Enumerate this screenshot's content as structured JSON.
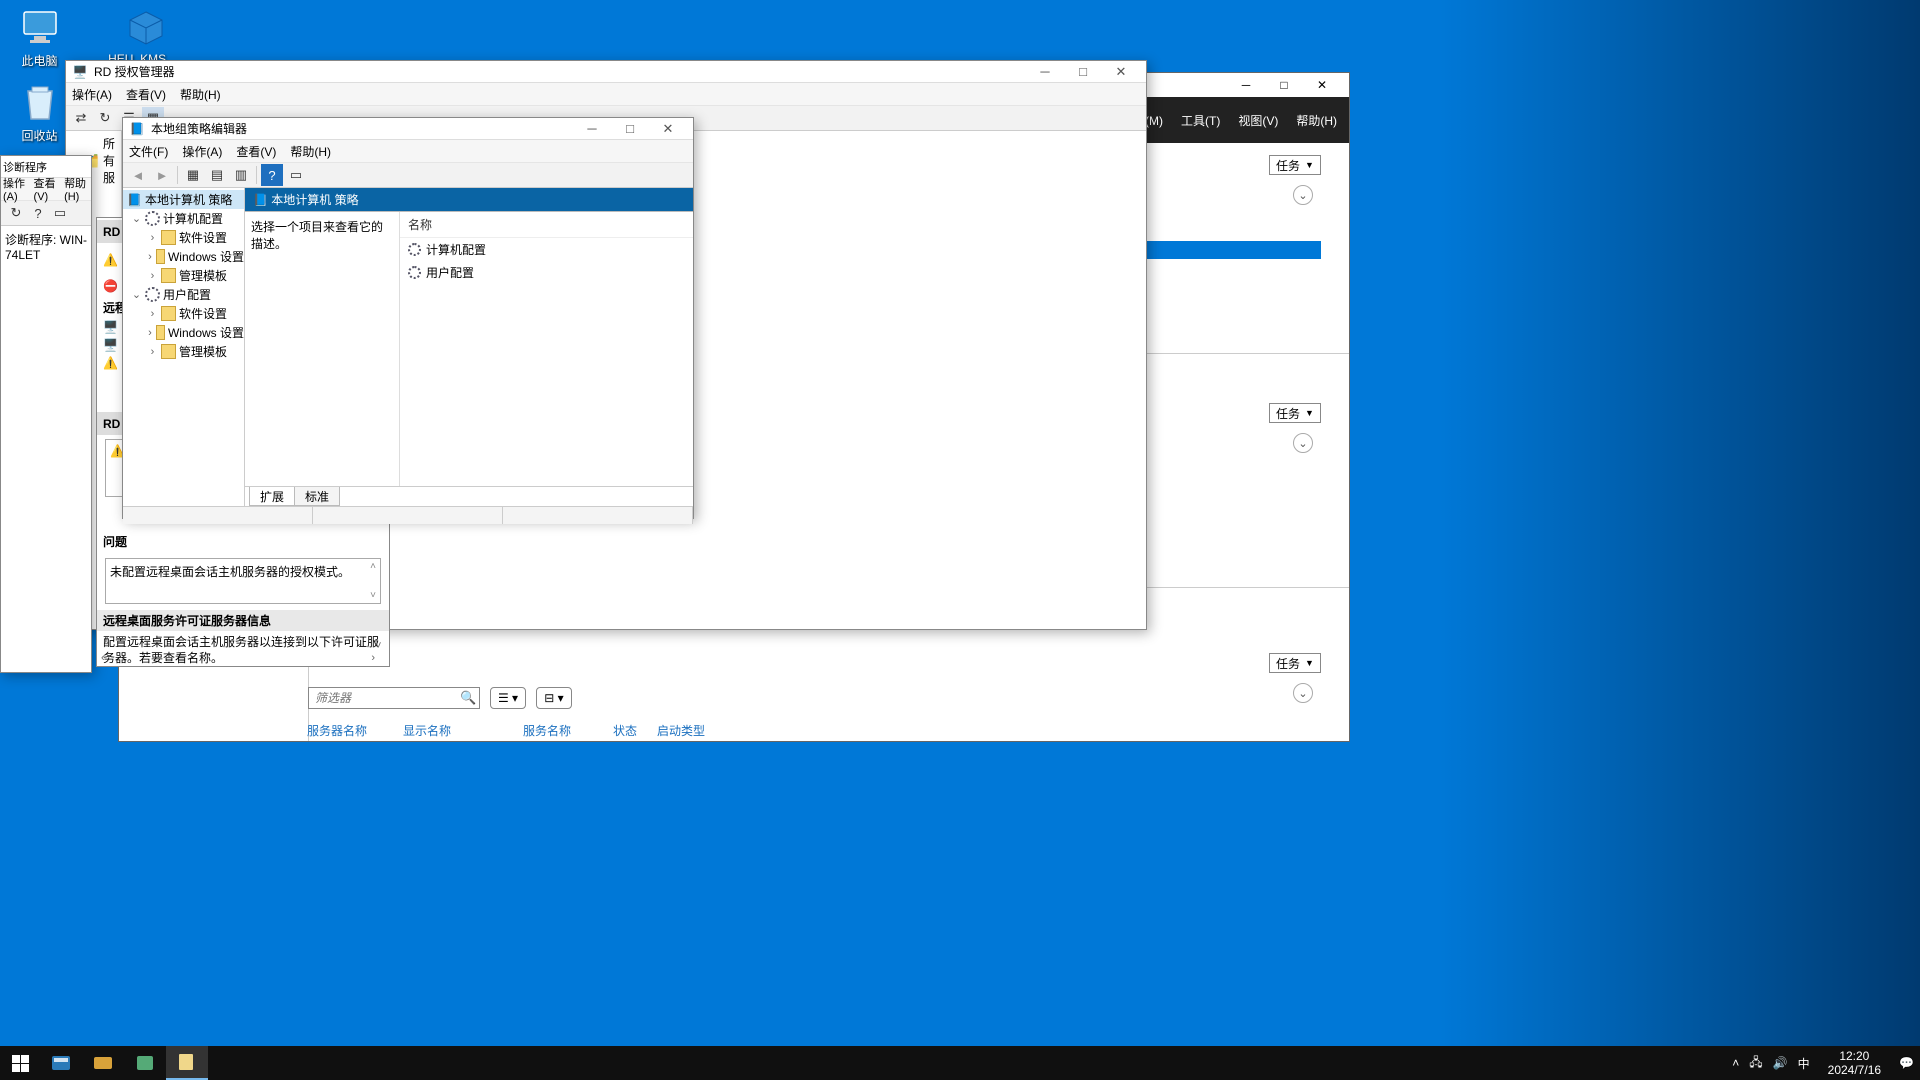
{
  "desktop": {
    "this_pc": "此电脑",
    "heu": "HEU_KMS_...",
    "recycle": "回收站"
  },
  "server_manager": {
    "menus": {
      "manage": "管理(M)",
      "tools": "工具(T)",
      "view": "视图(V)",
      "help": "帮助(H)"
    },
    "task_label": "任务",
    "filter_placeholder": "筛选器",
    "cols": {
      "server_name": "服务器名称",
      "display_name": "显示名称",
      "service_name": "服务名称",
      "status": "状态",
      "start_type": "启动类型"
    }
  },
  "rd_license": {
    "title": "RD 授权管理器",
    "menus": {
      "action": "操作(A)",
      "view": "查看(V)",
      "help": "帮助(H)"
    },
    "tree_root": "所有服"
  },
  "rd_panel": {
    "header": "RD 授",
    "remote_label": "远程",
    "header2": "RD 授",
    "problem_label": "问题",
    "problem_text": "未配置远程桌面会话主机服务器的授权模式。",
    "license_server_section": "远程桌面服务许可证服务器信息",
    "license_server_text": "配置远程桌面会话主机服务器以连接到以下许可证服务器。若要查看名称。"
  },
  "diag": {
    "title": "诊断程序",
    "menus": {
      "action": "操作(A)",
      "view": "查看(V)",
      "help": "帮助(H)"
    },
    "footer": "诊断程序: WIN-74LET"
  },
  "gpedit": {
    "title": "本地组策略编辑器",
    "menus": {
      "file": "文件(F)",
      "action": "操作(A)",
      "view": "查看(V)",
      "help": "帮助(H)"
    },
    "tree": {
      "root": "本地计算机 策略",
      "computer": "计算机配置",
      "user": "用户配置",
      "software": "软件设置",
      "windows": "Windows 设置",
      "admin": "管理模板"
    },
    "content_header": "本地计算机 策略",
    "desc_prompt": "选择一个项目来查看它的描述。",
    "name_col": "名称",
    "items": {
      "computer": "计算机配置",
      "user": "用户配置"
    },
    "tabs": {
      "ext": "扩展",
      "std": "标准"
    }
  },
  "taskbar": {
    "ime": "中",
    "time": "12:20",
    "date": "2024/7/16"
  }
}
